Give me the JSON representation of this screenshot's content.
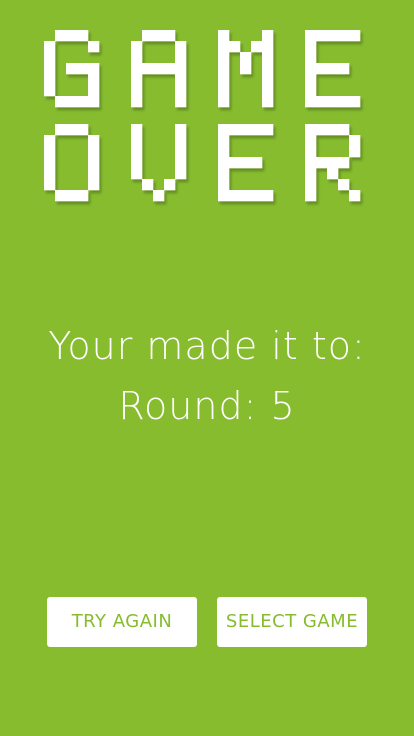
{
  "title": {
    "line1": "GAME",
    "line2": "OVER"
  },
  "message": {
    "line1": "Your made it to:",
    "line2_label": "Round:",
    "round": "5"
  },
  "buttons": {
    "try_again": "TRY AGAIN",
    "select_game": "SELECT GAME"
  },
  "colors": {
    "background": "#86bc2e",
    "text": "#ffffff",
    "button_bg": "#ffffff",
    "button_text": "#86bc2e"
  }
}
